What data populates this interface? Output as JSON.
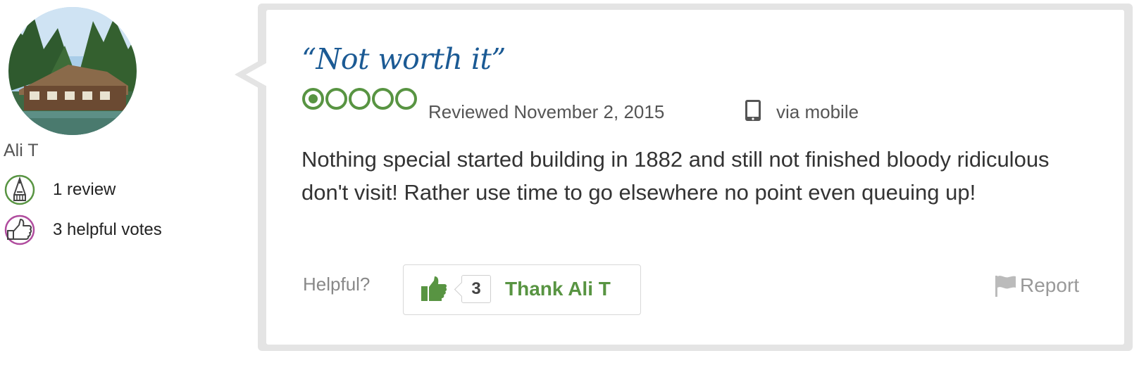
{
  "reviewer": {
    "name": "Ali T",
    "reviews_text": "1 review",
    "helpful_votes_text": "3 helpful votes"
  },
  "review": {
    "title": "“Not worth it”",
    "rating": 1,
    "rating_max": 5,
    "date_text": "Reviewed November 2, 2015",
    "via_text": "via mobile",
    "body": "Nothing special started building in 1882 and still not finished bloody ridiculous don't visit! Rather use time to go elsewhere no point even queuing up!"
  },
  "actions": {
    "helpful_label": "Helpful?",
    "thank_count": "3",
    "thank_label": "Thank Ali T",
    "report_label": "Report"
  },
  "colors": {
    "title": "#1b5a94",
    "rating_green": "#589442",
    "reviews_badge": "#589442",
    "votes_badge": "#b04c9e"
  },
  "icons": {
    "reviews_badge": "pencil-badge-icon",
    "votes_badge": "thumbs-up-badge-icon",
    "device": "mobile-phone-icon",
    "thank": "thumbs-up-icon",
    "report": "flag-icon"
  }
}
